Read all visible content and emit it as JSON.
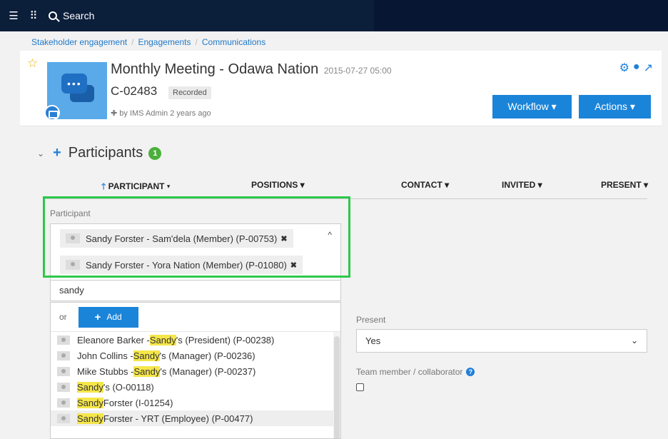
{
  "topbar": {
    "search_label": "Search"
  },
  "breadcrumb": [
    "Stakeholder engagement",
    "Engagements",
    "Communications"
  ],
  "header": {
    "title": "Monthly Meeting - Odawa Nation",
    "datetime": "2015-07-27 05:00",
    "code": "C-02483",
    "status_badge": "Recorded",
    "byline": "by IMS Admin 2 years ago",
    "workflow_label": "Workflow ▾",
    "actions_label": "Actions ▾"
  },
  "participants": {
    "title": "Participants",
    "count": "1",
    "columns": [
      "PARTICIPANT ▾",
      "POSITIONS ▾",
      "CONTACT ▾",
      "INVITED ▾",
      "PRESENT ▾"
    ],
    "field_label": "Participant",
    "selected": [
      "Sandy Forster - Sam'dela (Member) (P-00753)",
      "Sandy Forster - Yora Nation (Member) (P-01080)"
    ],
    "search_value": "sandy",
    "or_label": "or",
    "add_label": "Add",
    "results": [
      {
        "before": "Eleanore Barker - ",
        "match": "Sandy",
        "after": "'s (President) (P-00238)"
      },
      {
        "before": "John Collins - ",
        "match": "Sandy",
        "after": "'s (Manager) (P-00236)"
      },
      {
        "before": "Mike Stubbs - ",
        "match": "Sandy",
        "after": "'s (Manager) (P-00237)"
      },
      {
        "before": "",
        "match": "Sandy",
        "after": "'s (O-00118)"
      },
      {
        "before": "",
        "match": "Sandy",
        "after": " Forster (I-01254)"
      },
      {
        "before": "",
        "match": "Sandy",
        "after": " Forster - YRT (Employee) (P-00477)"
      }
    ]
  },
  "fields": {
    "present_label": "Present",
    "present_value": "Yes",
    "team_label": "Team member / collaborator"
  }
}
